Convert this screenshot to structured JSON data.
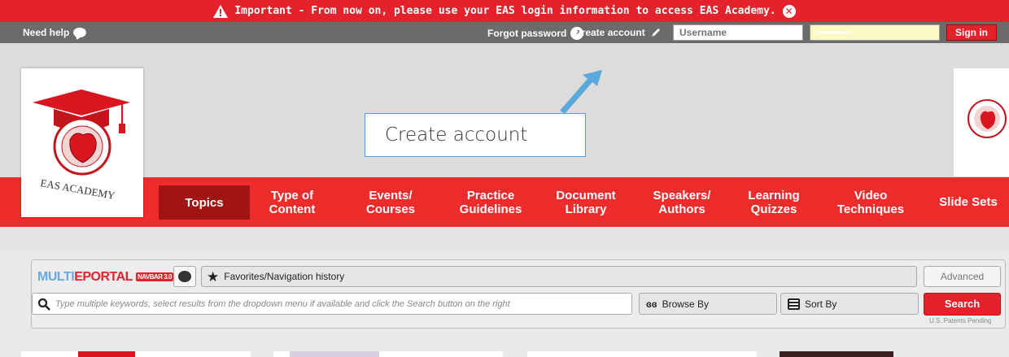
{
  "alert": {
    "text": "Important - From now on, please use your EAS login information to access EAS Academy."
  },
  "loginbar": {
    "need_help": "Need help",
    "forgot_password": "Forgot password",
    "create_account": "Create account",
    "username_placeholder": "Username",
    "password_value": "••••••••••",
    "sign_in": "Sign in"
  },
  "callout": {
    "text": "Create account"
  },
  "logo": {
    "text": "EAS ACADEMY"
  },
  "nav": {
    "items": [
      {
        "label": "Topics"
      },
      {
        "label": "Type of Content"
      },
      {
        "label": "Events/ Courses"
      },
      {
        "label": "Practice Guidelines"
      },
      {
        "label": "Document Library"
      },
      {
        "label": "Speakers/ Authors"
      },
      {
        "label": "Learning Quizzes"
      },
      {
        "label": "Video Techniques"
      },
      {
        "label": "Slide Sets"
      }
    ]
  },
  "portal": {
    "logo_a": "MULTI",
    "logo_b": "EPORTAL",
    "badge": "NAVBAR 3.0",
    "favorites": "Favorites/Navigation history",
    "advanced": "Advanced",
    "search_placeholder": "Type multiple keywords, select results from the dropdown menu if available and click the Search button on the right",
    "browse_by": "Browse By",
    "sort_by": "Sort By",
    "search": "Search",
    "patent": "U.S. Patents Pending"
  },
  "colors": {
    "brand_red": "#e3222b",
    "nav_red": "#ee2c2c",
    "active_tab": "#a11414",
    "callout_border": "#4ba3d6"
  }
}
